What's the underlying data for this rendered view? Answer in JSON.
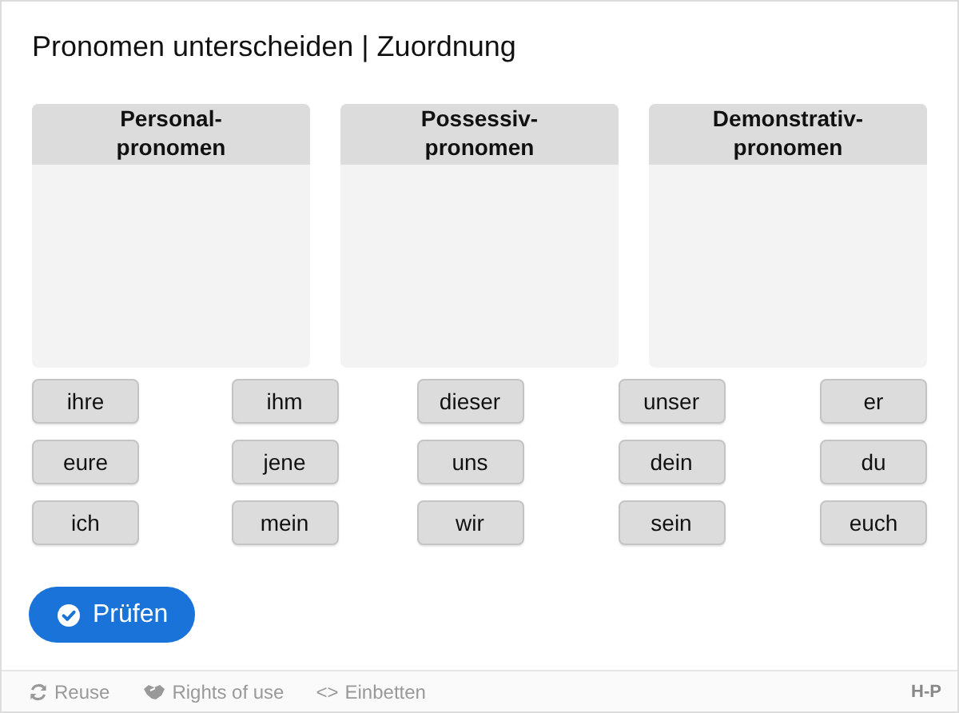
{
  "title": "Pronomen unterscheiden | Zuordnung",
  "dropzones": [
    {
      "label": "Personal-\npronomen"
    },
    {
      "label": "Possessiv-\npronomen"
    },
    {
      "label": "Demonstrativ-\npronomen"
    }
  ],
  "words": [
    "ihre",
    "ihm",
    "dieser",
    "unser",
    "er",
    "eure",
    "jene",
    "uns",
    "dein",
    "du",
    "ich",
    "mein",
    "wir",
    "sein",
    "euch"
  ],
  "check_button": {
    "label": "Prüfen"
  },
  "footer": {
    "links": [
      {
        "kind": "reuse",
        "label": "Reuse"
      },
      {
        "kind": "rights",
        "label": "Rights of use"
      },
      {
        "kind": "embed",
        "glyph": "<>",
        "label": "Einbetten"
      }
    ],
    "logo": "H-P"
  }
}
